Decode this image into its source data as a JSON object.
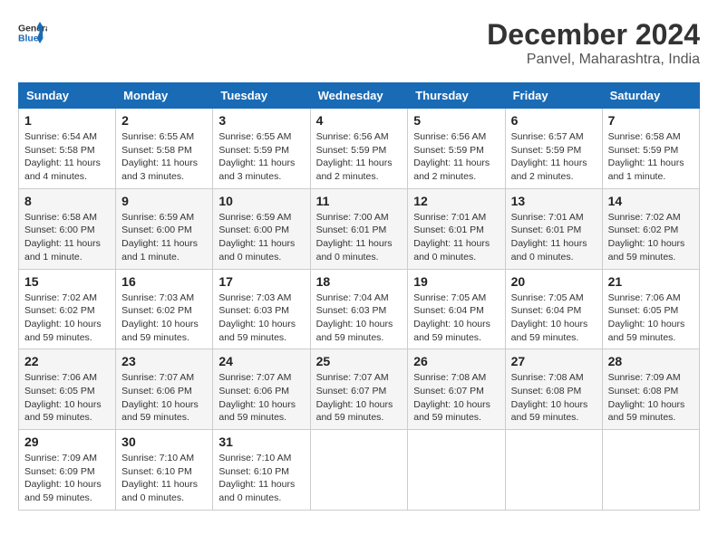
{
  "header": {
    "logo_line1": "General",
    "logo_line2": "Blue",
    "month": "December 2024",
    "location": "Panvel, Maharashtra, India"
  },
  "weekdays": [
    "Sunday",
    "Monday",
    "Tuesday",
    "Wednesday",
    "Thursday",
    "Friday",
    "Saturday"
  ],
  "weeks": [
    [
      {
        "day": "1",
        "sunrise": "Sunrise: 6:54 AM",
        "sunset": "Sunset: 5:58 PM",
        "daylight": "Daylight: 11 hours and 4 minutes."
      },
      {
        "day": "2",
        "sunrise": "Sunrise: 6:55 AM",
        "sunset": "Sunset: 5:58 PM",
        "daylight": "Daylight: 11 hours and 3 minutes."
      },
      {
        "day": "3",
        "sunrise": "Sunrise: 6:55 AM",
        "sunset": "Sunset: 5:59 PM",
        "daylight": "Daylight: 11 hours and 3 minutes."
      },
      {
        "day": "4",
        "sunrise": "Sunrise: 6:56 AM",
        "sunset": "Sunset: 5:59 PM",
        "daylight": "Daylight: 11 hours and 2 minutes."
      },
      {
        "day": "5",
        "sunrise": "Sunrise: 6:56 AM",
        "sunset": "Sunset: 5:59 PM",
        "daylight": "Daylight: 11 hours and 2 minutes."
      },
      {
        "day": "6",
        "sunrise": "Sunrise: 6:57 AM",
        "sunset": "Sunset: 5:59 PM",
        "daylight": "Daylight: 11 hours and 2 minutes."
      },
      {
        "day": "7",
        "sunrise": "Sunrise: 6:58 AM",
        "sunset": "Sunset: 5:59 PM",
        "daylight": "Daylight: 11 hours and 1 minute."
      }
    ],
    [
      {
        "day": "8",
        "sunrise": "Sunrise: 6:58 AM",
        "sunset": "Sunset: 6:00 PM",
        "daylight": "Daylight: 11 hours and 1 minute."
      },
      {
        "day": "9",
        "sunrise": "Sunrise: 6:59 AM",
        "sunset": "Sunset: 6:00 PM",
        "daylight": "Daylight: 11 hours and 1 minute."
      },
      {
        "day": "10",
        "sunrise": "Sunrise: 6:59 AM",
        "sunset": "Sunset: 6:00 PM",
        "daylight": "Daylight: 11 hours and 0 minutes."
      },
      {
        "day": "11",
        "sunrise": "Sunrise: 7:00 AM",
        "sunset": "Sunset: 6:01 PM",
        "daylight": "Daylight: 11 hours and 0 minutes."
      },
      {
        "day": "12",
        "sunrise": "Sunrise: 7:01 AM",
        "sunset": "Sunset: 6:01 PM",
        "daylight": "Daylight: 11 hours and 0 minutes."
      },
      {
        "day": "13",
        "sunrise": "Sunrise: 7:01 AM",
        "sunset": "Sunset: 6:01 PM",
        "daylight": "Daylight: 11 hours and 0 minutes."
      },
      {
        "day": "14",
        "sunrise": "Sunrise: 7:02 AM",
        "sunset": "Sunset: 6:02 PM",
        "daylight": "Daylight: 10 hours and 59 minutes."
      }
    ],
    [
      {
        "day": "15",
        "sunrise": "Sunrise: 7:02 AM",
        "sunset": "Sunset: 6:02 PM",
        "daylight": "Daylight: 10 hours and 59 minutes."
      },
      {
        "day": "16",
        "sunrise": "Sunrise: 7:03 AM",
        "sunset": "Sunset: 6:02 PM",
        "daylight": "Daylight: 10 hours and 59 minutes."
      },
      {
        "day": "17",
        "sunrise": "Sunrise: 7:03 AM",
        "sunset": "Sunset: 6:03 PM",
        "daylight": "Daylight: 10 hours and 59 minutes."
      },
      {
        "day": "18",
        "sunrise": "Sunrise: 7:04 AM",
        "sunset": "Sunset: 6:03 PM",
        "daylight": "Daylight: 10 hours and 59 minutes."
      },
      {
        "day": "19",
        "sunrise": "Sunrise: 7:05 AM",
        "sunset": "Sunset: 6:04 PM",
        "daylight": "Daylight: 10 hours and 59 minutes."
      },
      {
        "day": "20",
        "sunrise": "Sunrise: 7:05 AM",
        "sunset": "Sunset: 6:04 PM",
        "daylight": "Daylight: 10 hours and 59 minutes."
      },
      {
        "day": "21",
        "sunrise": "Sunrise: 7:06 AM",
        "sunset": "Sunset: 6:05 PM",
        "daylight": "Daylight: 10 hours and 59 minutes."
      }
    ],
    [
      {
        "day": "22",
        "sunrise": "Sunrise: 7:06 AM",
        "sunset": "Sunset: 6:05 PM",
        "daylight": "Daylight: 10 hours and 59 minutes."
      },
      {
        "day": "23",
        "sunrise": "Sunrise: 7:07 AM",
        "sunset": "Sunset: 6:06 PM",
        "daylight": "Daylight: 10 hours and 59 minutes."
      },
      {
        "day": "24",
        "sunrise": "Sunrise: 7:07 AM",
        "sunset": "Sunset: 6:06 PM",
        "daylight": "Daylight: 10 hours and 59 minutes."
      },
      {
        "day": "25",
        "sunrise": "Sunrise: 7:07 AM",
        "sunset": "Sunset: 6:07 PM",
        "daylight": "Daylight: 10 hours and 59 minutes."
      },
      {
        "day": "26",
        "sunrise": "Sunrise: 7:08 AM",
        "sunset": "Sunset: 6:07 PM",
        "daylight": "Daylight: 10 hours and 59 minutes."
      },
      {
        "day": "27",
        "sunrise": "Sunrise: 7:08 AM",
        "sunset": "Sunset: 6:08 PM",
        "daylight": "Daylight: 10 hours and 59 minutes."
      },
      {
        "day": "28",
        "sunrise": "Sunrise: 7:09 AM",
        "sunset": "Sunset: 6:08 PM",
        "daylight": "Daylight: 10 hours and 59 minutes."
      }
    ],
    [
      {
        "day": "29",
        "sunrise": "Sunrise: 7:09 AM",
        "sunset": "Sunset: 6:09 PM",
        "daylight": "Daylight: 10 hours and 59 minutes."
      },
      {
        "day": "30",
        "sunrise": "Sunrise: 7:10 AM",
        "sunset": "Sunset: 6:10 PM",
        "daylight": "Daylight: 11 hours and 0 minutes."
      },
      {
        "day": "31",
        "sunrise": "Sunrise: 7:10 AM",
        "sunset": "Sunset: 6:10 PM",
        "daylight": "Daylight: 11 hours and 0 minutes."
      },
      null,
      null,
      null,
      null
    ]
  ]
}
